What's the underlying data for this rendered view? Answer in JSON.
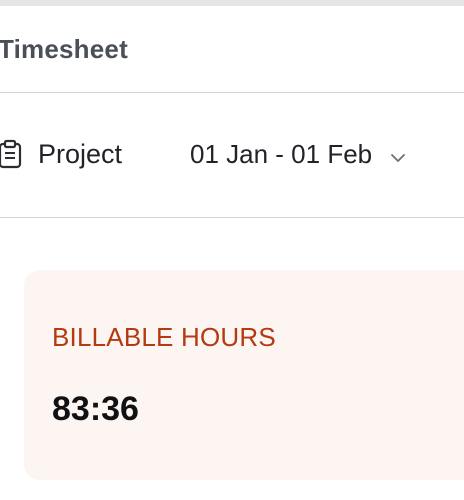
{
  "header": {
    "title": "Timesheet"
  },
  "toolbar": {
    "project_label": "Project",
    "project_icon": "clipboard-icon",
    "date_range": "01 Jan - 01 Feb",
    "date_icon": "chevron-down-icon"
  },
  "summary_card": {
    "label": "BILLABLE HOURS",
    "value": "83:36"
  },
  "colors": {
    "card_background": "#fcf5f1",
    "label_accent": "#b33a12"
  }
}
